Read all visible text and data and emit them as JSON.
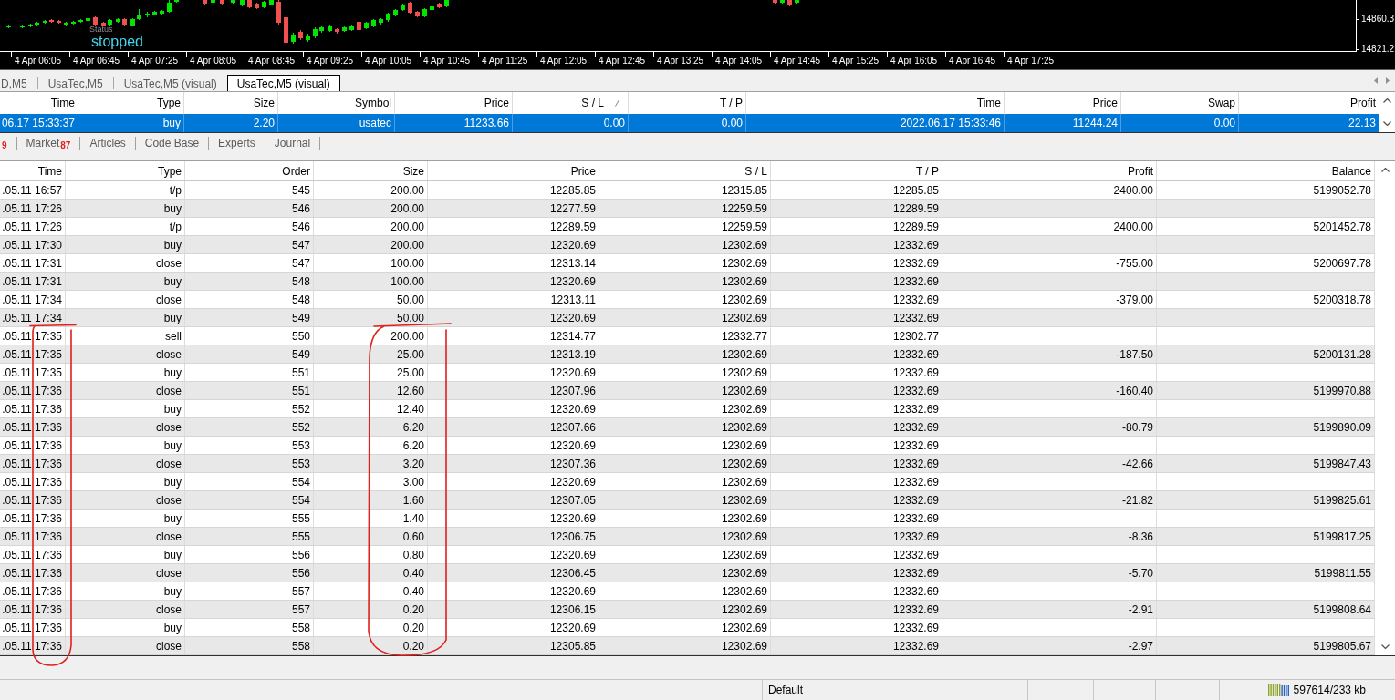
{
  "chart": {
    "status_label": "Status",
    "status_value": "stopped",
    "time_labels": [
      "4 Apr 06:05",
      "4 Apr 06:45",
      "4 Apr 07:25",
      "4 Apr 08:05",
      "4 Apr 08:45",
      "4 Apr 09:25",
      "4 Apr 10:05",
      "4 Apr 10:45",
      "4 Apr 11:25",
      "4 Apr 12:05",
      "4 Apr 12:45",
      "4 Apr 13:25",
      "4 Apr 14:05",
      "4 Apr 14:45",
      "4 Apr 15:25",
      "4 Apr 16:05",
      "4 Apr 16:45",
      "4 Apr 17:25"
    ],
    "price_labels": [
      "14860.3",
      "14821.2"
    ]
  },
  "chart_tabs": [
    {
      "label": "D,M5",
      "selected": false
    },
    {
      "label": "UsaTec,M5",
      "selected": false
    },
    {
      "label": "UsaTec,M5 (visual)",
      "selected": false
    },
    {
      "label": "UsaTec,M5 (visual)",
      "selected": true
    }
  ],
  "positions_table": {
    "columns": [
      {
        "label": "Time",
        "slash_mark": false
      },
      {
        "label": "Type",
        "slash_mark": false
      },
      {
        "label": "Size",
        "slash_mark": false
      },
      {
        "label": "Symbol",
        "slash_mark": false
      },
      {
        "label": "Price",
        "slash_mark": false
      },
      {
        "label": "S / L",
        "slash_mark": true
      },
      {
        "label": "T / P",
        "slash_mark": false
      },
      {
        "label": "Time",
        "slash_mark": false
      },
      {
        "label": "Price",
        "slash_mark": false
      },
      {
        "label": "Swap",
        "slash_mark": false
      },
      {
        "label": "Profit",
        "slash_mark": false
      }
    ],
    "rows": [
      {
        "selected": true,
        "cells": [
          "06.17 15:33:37",
          "buy",
          "2.20",
          "usatec",
          "11233.66",
          "0.00",
          "0.00",
          "2022.06.17 15:33:46",
          "11244.24",
          "0.00",
          "22.13"
        ]
      }
    ]
  },
  "terminal_tabs": [
    {
      "badge": "9",
      "selected": false
    },
    {
      "label": "Market",
      "badge": "87",
      "selected": false
    },
    {
      "label": "Articles",
      "selected": false
    },
    {
      "label": "Code Base",
      "selected": false
    },
    {
      "label": "Experts",
      "selected": false
    },
    {
      "label": "Journal",
      "selected": false
    }
  ],
  "history_table": {
    "columns": [
      "Time",
      "Type",
      "Order",
      "Size",
      "Price",
      "S / L",
      "T / P",
      "Profit",
      "Balance"
    ],
    "rows": [
      [
        ".05.11 16:57",
        "t/p",
        "545",
        "200.00",
        "12285.85",
        "12315.85",
        "12285.85",
        "2400.00",
        "5199052.78"
      ],
      [
        ".05.11 17:26",
        "buy",
        "546",
        "200.00",
        "12277.59",
        "12259.59",
        "12289.59"
      ],
      [
        ".05.11 17:26",
        "t/p",
        "546",
        "200.00",
        "12289.59",
        "12259.59",
        "12289.59",
        "2400.00",
        "5201452.78"
      ],
      [
        ".05.11 17:30",
        "buy",
        "547",
        "200.00",
        "12320.69",
        "12302.69",
        "12332.69"
      ],
      [
        ".05.11 17:31",
        "close",
        "547",
        "100.00",
        "12313.14",
        "12302.69",
        "12332.69",
        "-755.00",
        "5200697.78"
      ],
      [
        ".05.11 17:31",
        "buy",
        "548",
        "100.00",
        "12320.69",
        "12302.69",
        "12332.69"
      ],
      [
        ".05.11 17:34",
        "close",
        "548",
        "50.00",
        "12313.11",
        "12302.69",
        "12332.69",
        "-379.00",
        "5200318.78"
      ],
      [
        ".05.11 17:34",
        "buy",
        "549",
        "50.00",
        "12320.69",
        "12302.69",
        "12332.69"
      ],
      [
        ".05.11 17:35",
        "sell",
        "550",
        "200.00",
        "12314.77",
        "12332.77",
        "12302.77"
      ],
      [
        ".05.11 17:35",
        "close",
        "549",
        "25.00",
        "12313.19",
        "12302.69",
        "12332.69",
        "-187.50",
        "5200131.28"
      ],
      [
        ".05.11 17:35",
        "buy",
        "551",
        "25.00",
        "12320.69",
        "12302.69",
        "12332.69"
      ],
      [
        ".05.11 17:36",
        "close",
        "551",
        "12.60",
        "12307.96",
        "12302.69",
        "12332.69",
        "-160.40",
        "5199970.88"
      ],
      [
        ".05.11 17:36",
        "buy",
        "552",
        "12.40",
        "12320.69",
        "12302.69",
        "12332.69"
      ],
      [
        ".05.11 17:36",
        "close",
        "552",
        "6.20",
        "12307.66",
        "12302.69",
        "12332.69",
        "-80.79",
        "5199890.09"
      ],
      [
        ".05.11 17:36",
        "buy",
        "553",
        "6.20",
        "12320.69",
        "12302.69",
        "12332.69"
      ],
      [
        ".05.11 17:36",
        "close",
        "553",
        "3.20",
        "12307.36",
        "12302.69",
        "12332.69",
        "-42.66",
        "5199847.43"
      ],
      [
        ".05.11 17:36",
        "buy",
        "554",
        "3.00",
        "12320.69",
        "12302.69",
        "12332.69"
      ],
      [
        ".05.11 17:36",
        "close",
        "554",
        "1.60",
        "12307.05",
        "12302.69",
        "12332.69",
        "-21.82",
        "5199825.61"
      ],
      [
        ".05.11 17:36",
        "buy",
        "555",
        "1.40",
        "12320.69",
        "12302.69",
        "12332.69"
      ],
      [
        ".05.11 17:36",
        "close",
        "555",
        "0.60",
        "12306.75",
        "12302.69",
        "12332.69",
        "-8.36",
        "5199817.25"
      ],
      [
        ".05.11 17:36",
        "buy",
        "556",
        "0.80",
        "12320.69",
        "12302.69",
        "12332.69"
      ],
      [
        ".05.11 17:36",
        "close",
        "556",
        "0.40",
        "12306.45",
        "12302.69",
        "12332.69",
        "-5.70",
        "5199811.55"
      ],
      [
        ".05.11 17:36",
        "buy",
        "557",
        "0.40",
        "12320.69",
        "12302.69",
        "12332.69"
      ],
      [
        ".05.11 17:36",
        "close",
        "557",
        "0.20",
        "12306.15",
        "12302.69",
        "12332.69",
        "-2.91",
        "5199808.64"
      ],
      [
        ".05.11 17:36",
        "buy",
        "558",
        "0.20",
        "12320.69",
        "12302.69",
        "12332.69"
      ],
      [
        ".05.11 17:36",
        "close",
        "558",
        "0.20",
        "12305.85",
        "12302.69",
        "12332.69",
        "-2.97",
        "5199805.67"
      ]
    ]
  },
  "status_bar": {
    "profile": "Default",
    "memory": "597614/233 kb"
  }
}
